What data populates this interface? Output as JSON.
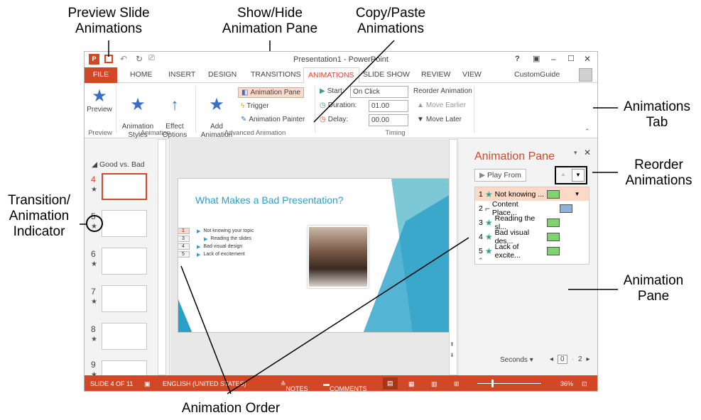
{
  "callouts": {
    "preview": "Preview Slide\nAnimations",
    "show_hide": "Show/Hide\nAnimation Pane",
    "copy_paste": "Copy/Paste\nAnimations",
    "animations_tab": "Animations\nTab",
    "reorder": "Reorder\nAnimations",
    "indicator": "Transition/\nAnimation\nIndicator",
    "pane": "Animation\nPane",
    "order": "Animation Order"
  },
  "window": {
    "title": "Presentation1 - PowerPoint",
    "user": "CustomGuide",
    "controls": [
      "?",
      "▣",
      "–",
      "☐",
      "✕"
    ]
  },
  "tabs": [
    "FILE",
    "HOME",
    "INSERT",
    "DESIGN",
    "TRANSITIONS",
    "ANIMATIONS",
    "SLIDE SHOW",
    "REVIEW",
    "VIEW"
  ],
  "ribbon": {
    "preview": "Preview",
    "animation_styles": "Animation\nStyles",
    "effect_options": "Effect\nOptions",
    "add_animation": "Add\nAnimation",
    "animation_pane": "Animation Pane",
    "trigger": "Trigger",
    "animation_painter": "Animation Painter",
    "start_label": "Start:",
    "start_value": "On Click",
    "duration_label": "Duration:",
    "duration_value": "01.00",
    "delay_label": "Delay:",
    "delay_value": "00.00",
    "reorder_label": "Reorder Animation",
    "move_earlier": "Move Earlier",
    "move_later": "Move Later",
    "groups": [
      "Preview",
      "Animation",
      "Advanced Animation",
      "Timing"
    ]
  },
  "slides_panel": {
    "section": "Good vs. Bad",
    "numbers": [
      "4",
      "5",
      "6",
      "7",
      "8",
      "9"
    ]
  },
  "slide": {
    "title": "What Makes a Bad Presentation?",
    "bullets": [
      {
        "order": "1",
        "text": "Not knowing your topic"
      },
      {
        "order": "3",
        "text": "Reading the slides"
      },
      {
        "order": "4",
        "text": "Bad visual design"
      },
      {
        "order": "5",
        "text": "Lack of excitement"
      }
    ]
  },
  "pane": {
    "title": "Animation Pane",
    "play_from": "Play From",
    "items": [
      {
        "num": "1",
        "label": "Not knowing ...",
        "color": "#7fd36c"
      },
      {
        "num": "2",
        "label": "Content Place...",
        "color": "#8db4d8"
      },
      {
        "num": "3",
        "label": "Reading the sl...",
        "color": "#7fd36c"
      },
      {
        "num": "4",
        "label": "Bad visual des...",
        "color": "#7fd36c"
      },
      {
        "num": "5",
        "label": "Lack of excite...",
        "color": "#7fd36c"
      }
    ],
    "seconds": "Seconds",
    "timeline_start": "0",
    "timeline_end": "2"
  },
  "status": {
    "slide_of": "SLIDE 4 OF 11",
    "language": "ENGLISH (UNITED STATES)",
    "notes": "NOTES",
    "comments": "COMMENTS",
    "zoom": "36%"
  },
  "colors": {
    "accent": "#d24726",
    "pane_title": "#d24726",
    "slide_title": "#2aa0c8"
  }
}
